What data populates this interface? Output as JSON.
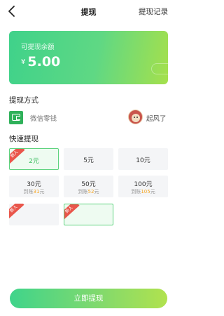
{
  "nav": {
    "title": "提现",
    "record_label": "提现记录"
  },
  "balance": {
    "label": "可提现余额",
    "currency": "¥",
    "amount": "5.00"
  },
  "method": {
    "section_title": "提现方式",
    "icon": "wechat-wallet-icon",
    "label": "微信零钱",
    "nickname": "起风了"
  },
  "quick": {
    "section_title": "快速提现",
    "new_badge": "新人",
    "options": [
      {
        "amount": "2元",
        "badge": true,
        "selected": true
      },
      {
        "amount": "5元",
        "badge": false,
        "selected": false
      },
      {
        "amount": "10元",
        "badge": false,
        "selected": false
      },
      {
        "amount": "30元",
        "arrive_prefix": "到账",
        "arrive_value": "31",
        "arrive_suffix": "元",
        "badge": false,
        "selected": false
      },
      {
        "amount": "50元",
        "arrive_prefix": "到账",
        "arrive_value": "52",
        "arrive_suffix": "元",
        "badge": false,
        "selected": false
      },
      {
        "amount": "100元",
        "arrive_prefix": "到账",
        "arrive_value": "105",
        "arrive_suffix": "元",
        "badge": false,
        "selected": false
      },
      {
        "amount": "",
        "badge": true,
        "selected": false
      },
      {
        "amount": "",
        "badge": true,
        "selected": true
      }
    ]
  },
  "submit_label": "立即提现",
  "colors": {
    "accent_green": "#3fd28a",
    "accent_lime": "#a5e04c",
    "badge_red": "#e9564b",
    "bonus_orange": "#f5a623",
    "wechat_green": "#2fb15a"
  }
}
